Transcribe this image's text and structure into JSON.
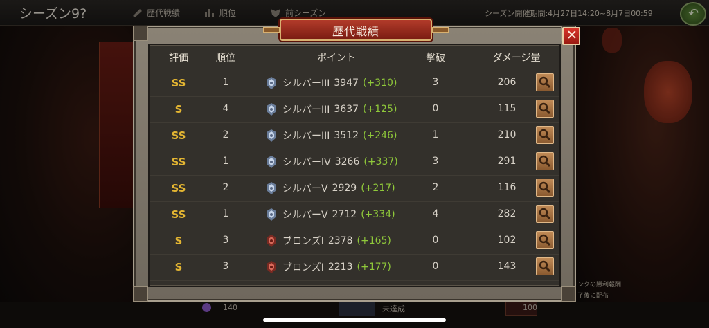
{
  "topbar": {
    "season_title": "シーズン9?",
    "nav": [
      {
        "label": "歴代戦績",
        "icon": "scroll-icon"
      },
      {
        "label": "順位",
        "icon": "bar-chart-icon"
      },
      {
        "label": "前シーズン",
        "icon": "crest-icon"
      }
    ],
    "period": "シーズン開催期間:4月27日14:20~8月7日00:59"
  },
  "background": {
    "right_notes": [
      "ンクの勝利報酬",
      "了後に配布"
    ],
    "bottom": {
      "currency_value": "140",
      "mission_status": "未達成",
      "reward_count": "100"
    }
  },
  "modal": {
    "title": "歴代戦績",
    "close_label": "✕",
    "columns": [
      "評価",
      "順位",
      "ポイント",
      "撃破",
      "ダメージ量"
    ],
    "rows": [
      {
        "grade": "SS",
        "rank": "1",
        "tier_icon": "silver",
        "tier": "シルバーIII",
        "points": "3947",
        "gain": "(+310)",
        "kills": "3",
        "damage": "206"
      },
      {
        "grade": "S",
        "rank": "4",
        "tier_icon": "silver",
        "tier": "シルバーIII",
        "points": "3637",
        "gain": "(+125)",
        "kills": "0",
        "damage": "115"
      },
      {
        "grade": "SS",
        "rank": "2",
        "tier_icon": "silver",
        "tier": "シルバーIII",
        "points": "3512",
        "gain": "(+246)",
        "kills": "1",
        "damage": "210"
      },
      {
        "grade": "SS",
        "rank": "1",
        "tier_icon": "silver",
        "tier": "シルバーIV",
        "points": "3266",
        "gain": "(+337)",
        "kills": "3",
        "damage": "291"
      },
      {
        "grade": "SS",
        "rank": "2",
        "tier_icon": "silver",
        "tier": "シルバーV",
        "points": "2929",
        "gain": "(+217)",
        "kills": "2",
        "damage": "116"
      },
      {
        "grade": "SS",
        "rank": "1",
        "tier_icon": "silver",
        "tier": "シルバーV",
        "points": "2712",
        "gain": "(+334)",
        "kills": "4",
        "damage": "282"
      },
      {
        "grade": "S",
        "rank": "3",
        "tier_icon": "bronze",
        "tier": "ブロンズI",
        "points": "2378",
        "gain": "(+165)",
        "kills": "0",
        "damage": "102"
      },
      {
        "grade": "S",
        "rank": "3",
        "tier_icon": "bronze",
        "tier": "ブロンズI",
        "points": "2213",
        "gain": "(+177)",
        "kills": "0",
        "damage": "143"
      }
    ]
  },
  "colors": {
    "grade": "#e3b532",
    "gain": "#8fc83a",
    "silver_badge": "#9fb4d4",
    "bronze_badge": "#b8483a"
  }
}
